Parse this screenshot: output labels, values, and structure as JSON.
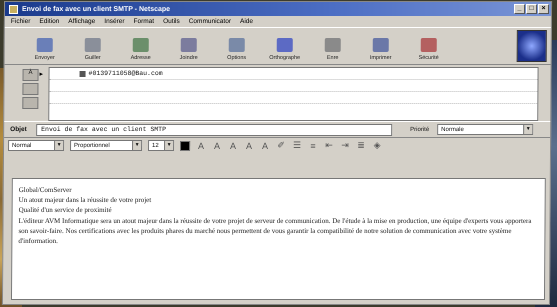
{
  "window": {
    "title": "Envoi de fax avec un client SMTP - Netscape"
  },
  "title_controls": [
    "_",
    "□",
    "×"
  ],
  "menu": [
    "Fichier",
    "Edition",
    "Affichage",
    "Insérer",
    "Format",
    "Outils",
    "Communicator",
    "Aide"
  ],
  "toolbar": [
    {
      "label": "Envoyer",
      "icon": "send-icon",
      "color": "#6a7fb8"
    },
    {
      "label": "Guiller",
      "icon": "quote-icon",
      "color": "#8a8f9a"
    },
    {
      "label": "Adresse",
      "icon": "address-icon",
      "color": "#6b8f6b"
    },
    {
      "label": "Joindre",
      "icon": "attach-icon",
      "color": "#7c7c9e"
    },
    {
      "label": "Options",
      "icon": "options-icon",
      "color": "#7a8aa8"
    },
    {
      "label": "Orthographe",
      "icon": "spelling-icon",
      "color": "#5c6ac4"
    },
    {
      "label": "Enre",
      "icon": "save-icon",
      "color": "#8a8a8a"
    },
    {
      "label": "Imprimer",
      "icon": "print-icon",
      "color": "#6b78a8"
    },
    {
      "label": "Sécurité",
      "icon": "security-icon",
      "color": "#b46060"
    }
  ],
  "addressing": {
    "to_tab": "À",
    "rows": [
      {
        "value": "#0139711058@Bau.com"
      },
      {
        "value": ""
      },
      {
        "value": ""
      }
    ]
  },
  "subject": {
    "label": "Objet",
    "value": "Envoi de fax avec un client SMTP"
  },
  "priority": {
    "label": "Priorité",
    "value": "Normale"
  },
  "format": {
    "style": "Normal",
    "font": "Proportionnel",
    "size": "12"
  },
  "message": {
    "lines": [
      "Global/ComServer",
      "Un atout majeur dans la réussite de votre projet",
      "Qualité d'un service de proximité",
      "L'éditeur AVM Informatique sera un atout majeur dans la réussite de votre projet de serveur de communication. De l'étude à la mise en production, une équipe d'experts vous apportera son savoir-faire. Nos certifications avec les produits phares du marché nous permettent de vous garantir la compatibilité de notre solution de communication avec votre système d'information."
    ]
  }
}
